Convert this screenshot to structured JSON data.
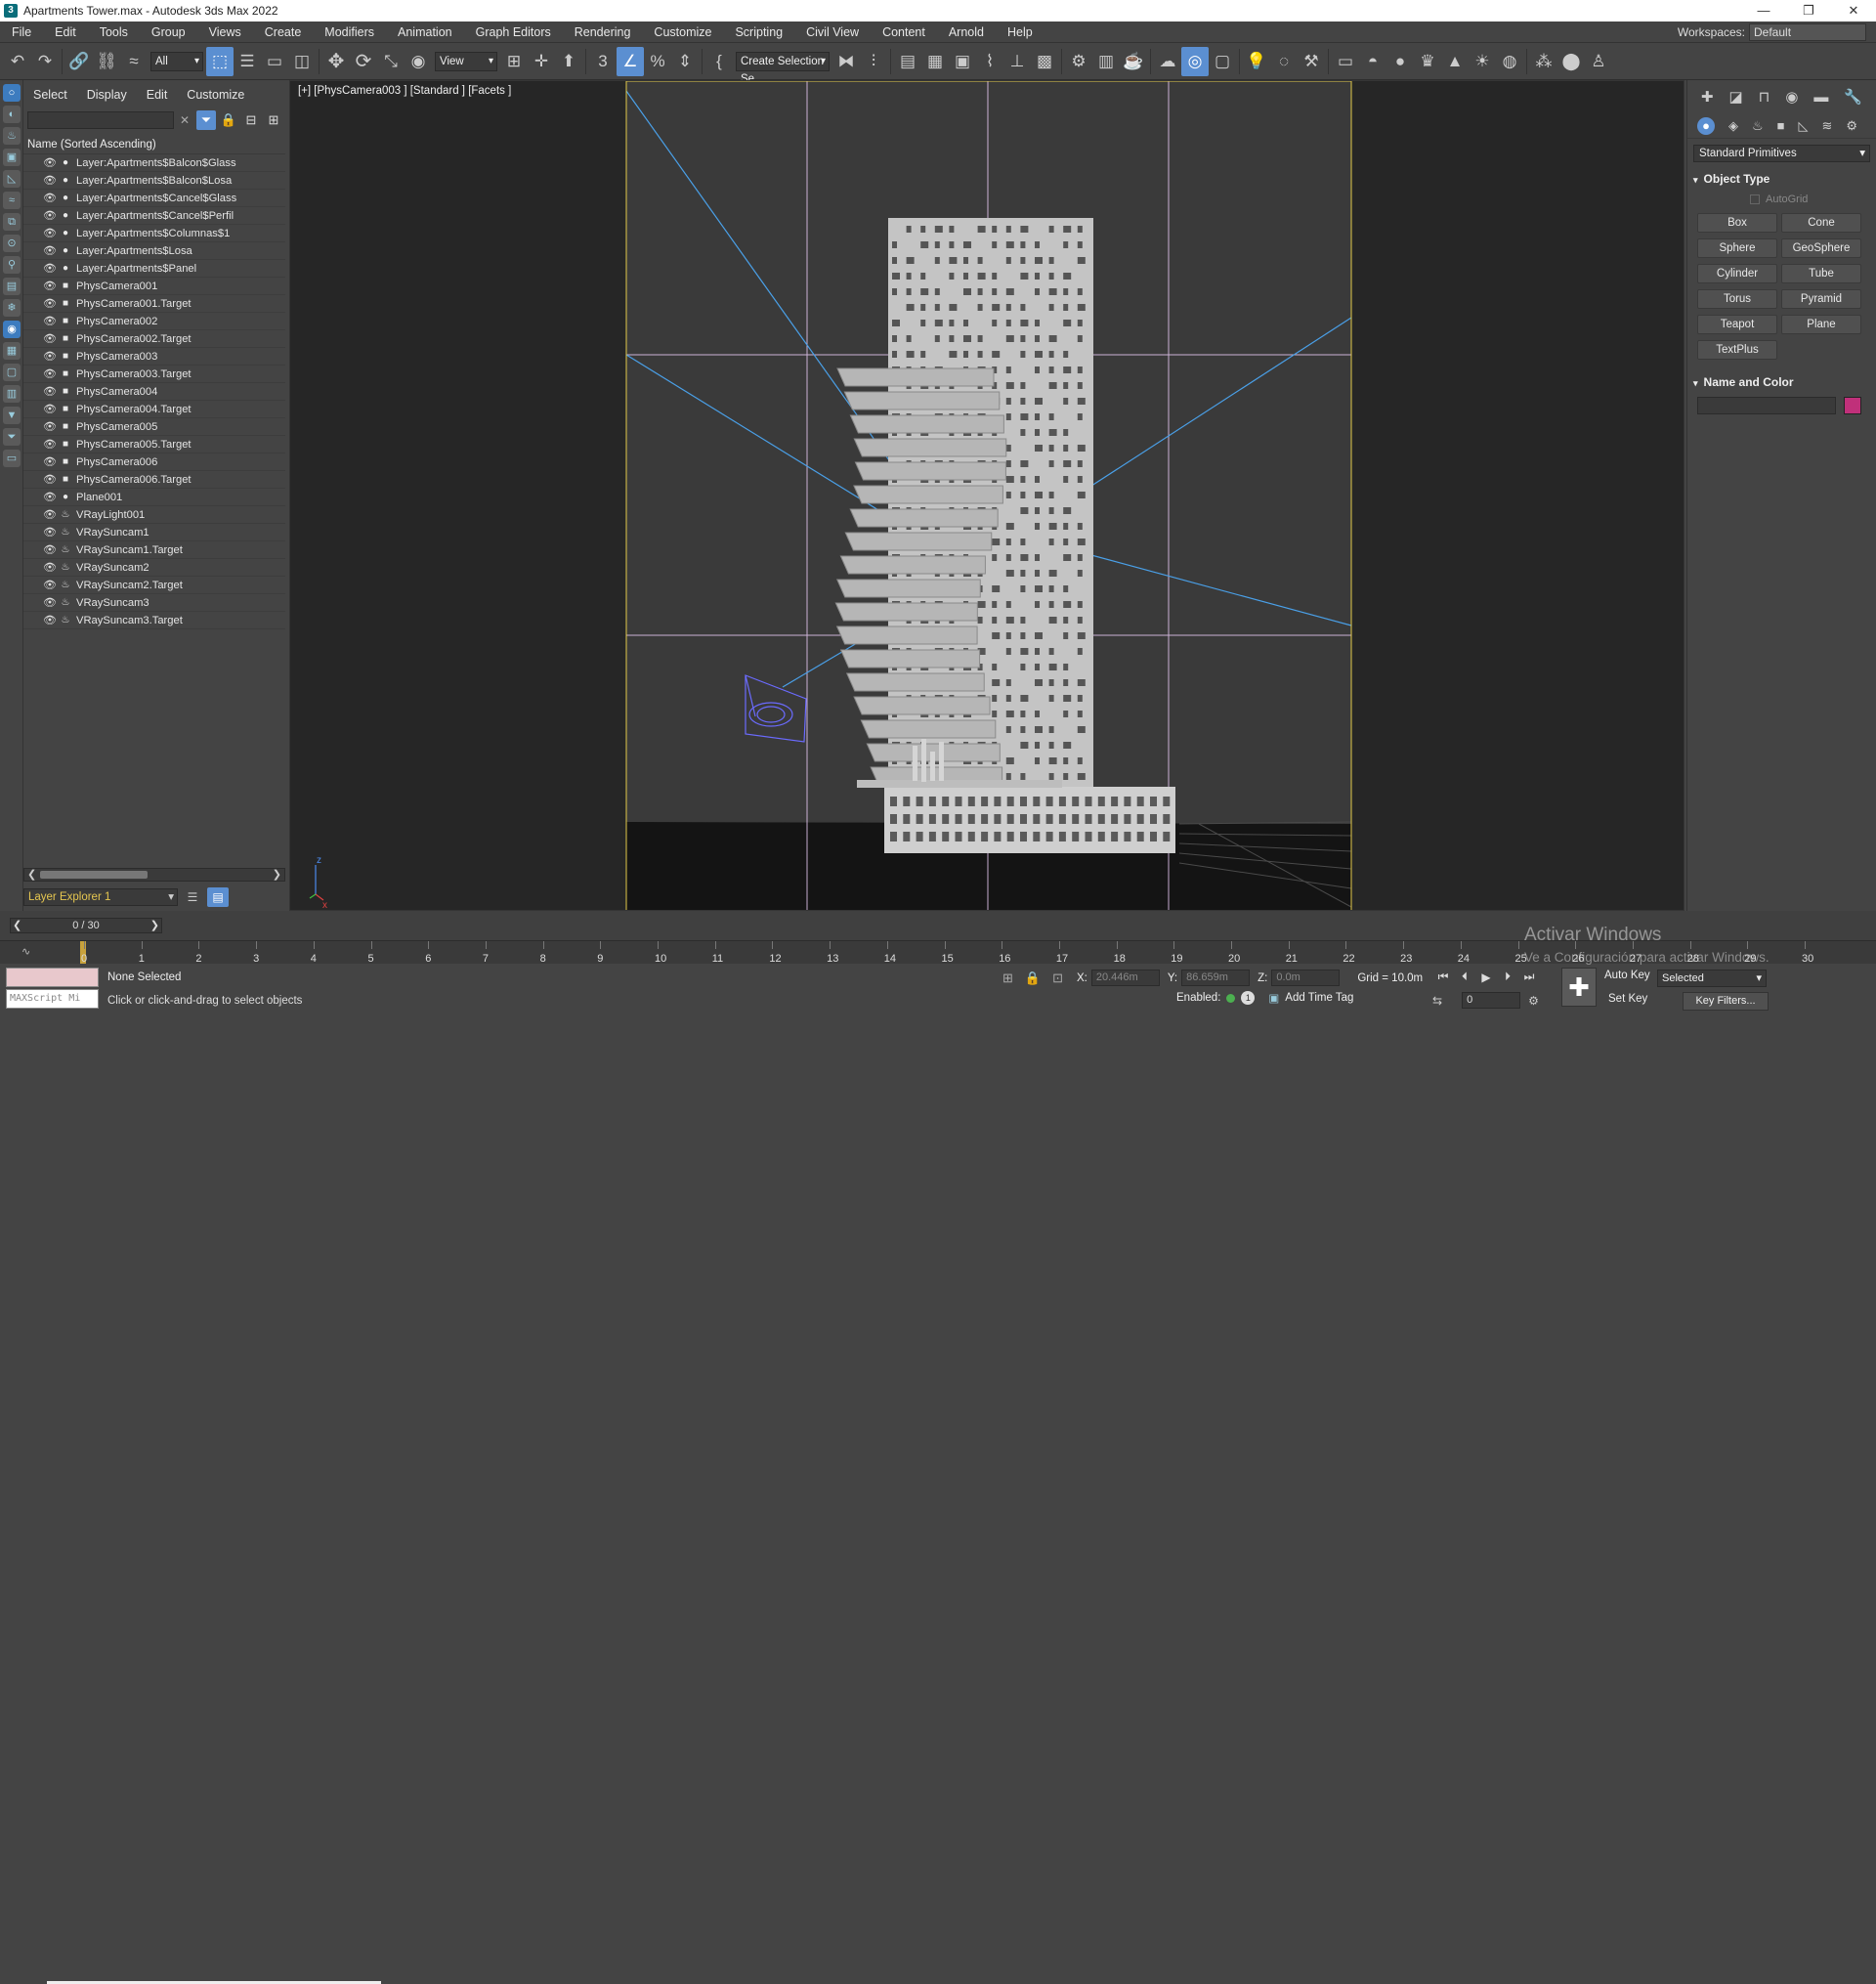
{
  "window": {
    "title": "Apartments Tower.max - Autodesk 3ds Max 2022",
    "controls": [
      "—",
      "❐",
      "✕"
    ]
  },
  "menu": [
    "File",
    "Edit",
    "Tools",
    "Group",
    "Views",
    "Create",
    "Modifiers",
    "Animation",
    "Graph Editors",
    "Rendering",
    "Customize",
    "Scripting",
    "Civil View",
    "Content",
    "Arnold",
    "Help"
  ],
  "workspace": {
    "label": "Workspaces:",
    "value": "Default"
  },
  "toolbar": {
    "filter_value": "All",
    "view_value": "View",
    "selection_set": "Create Selection Se"
  },
  "explorer": {
    "menu": [
      "Select",
      "Display",
      "Edit",
      "Customize"
    ],
    "column_header": "Name (Sorted Ascending)",
    "rows": [
      {
        "name": "Layer:Apartments$Balcon$Glass",
        "type": "geo"
      },
      {
        "name": "Layer:Apartments$Balcon$Losa",
        "type": "geo"
      },
      {
        "name": "Layer:Apartments$Cancel$Glass",
        "type": "geo"
      },
      {
        "name": "Layer:Apartments$Cancel$Perfil",
        "type": "geo"
      },
      {
        "name": "Layer:Apartments$Columnas$1",
        "type": "geo"
      },
      {
        "name": "Layer:Apartments$Losa",
        "type": "geo"
      },
      {
        "name": "Layer:Apartments$Panel",
        "type": "geo"
      },
      {
        "name": "PhysCamera001",
        "type": "camera"
      },
      {
        "name": "PhysCamera001.Target",
        "type": "camera"
      },
      {
        "name": "PhysCamera002",
        "type": "camera"
      },
      {
        "name": "PhysCamera002.Target",
        "type": "camera"
      },
      {
        "name": "PhysCamera003",
        "type": "camera"
      },
      {
        "name": "PhysCamera003.Target",
        "type": "camera"
      },
      {
        "name": "PhysCamera004",
        "type": "camera"
      },
      {
        "name": "PhysCamera004.Target",
        "type": "camera"
      },
      {
        "name": "PhysCamera005",
        "type": "camera"
      },
      {
        "name": "PhysCamera005.Target",
        "type": "camera"
      },
      {
        "name": "PhysCamera006",
        "type": "camera"
      },
      {
        "name": "PhysCamera006.Target",
        "type": "camera"
      },
      {
        "name": "Plane001",
        "type": "geo"
      },
      {
        "name": "VRayLight001",
        "type": "light"
      },
      {
        "name": "VRaySuncam1",
        "type": "light"
      },
      {
        "name": "VRaySuncam1.Target",
        "type": "light"
      },
      {
        "name": "VRaySuncam2",
        "type": "light"
      },
      {
        "name": "VRaySuncam2.Target",
        "type": "light"
      },
      {
        "name": "VRaySuncam3",
        "type": "light"
      },
      {
        "name": "VRaySuncam3.Target",
        "type": "light"
      }
    ],
    "layer_explorer": "Layer Explorer 1"
  },
  "viewport": {
    "label": "[+] [PhysCamera003 ] [Standard ] [Facets ]",
    "axis_z": "z",
    "axis_x": "x"
  },
  "command_panel": {
    "dropdown": "Standard Primitives",
    "object_type_title": "Object Type",
    "autogrid": "AutoGrid",
    "buttons": [
      "Box",
      "Cone",
      "Sphere",
      "GeoSphere",
      "Cylinder",
      "Tube",
      "Torus",
      "Pyramid",
      "Teapot",
      "Plane",
      "TextPlus"
    ],
    "name_color_title": "Name and Color",
    "object_color": "#c0307a"
  },
  "timeline": {
    "slider_text": "0 / 30",
    "ticks": [
      "0",
      "1",
      "2",
      "3",
      "4",
      "5",
      "6",
      "7",
      "8",
      "9",
      "10",
      "11",
      "12",
      "13",
      "14",
      "15",
      "16",
      "17",
      "18",
      "19",
      "20",
      "21",
      "22",
      "23",
      "24",
      "25",
      "26",
      "27",
      "28",
      "29",
      "30"
    ]
  },
  "status": {
    "maxscript": "MAXScript Mi",
    "selection": "None Selected",
    "prompt": "Click or click-and-drag to select objects",
    "x_label": "X:",
    "x_value": "20.446m",
    "y_label": "Y:",
    "y_value": "86.659m",
    "z_label": "Z:",
    "z_value": "0.0m",
    "grid": "Grid = 10.0m",
    "enabled": "Enabled:",
    "add_time_tag": "Add Time Tag",
    "frame_value": "0",
    "auto_key": "Auto Key",
    "set_key": "Set Key",
    "key_mode": "Selected",
    "key_filters": "Key Filters..."
  },
  "watermark": {
    "line1": "Activar Windows",
    "line2": "Ve a Configuración para activar Windows."
  }
}
